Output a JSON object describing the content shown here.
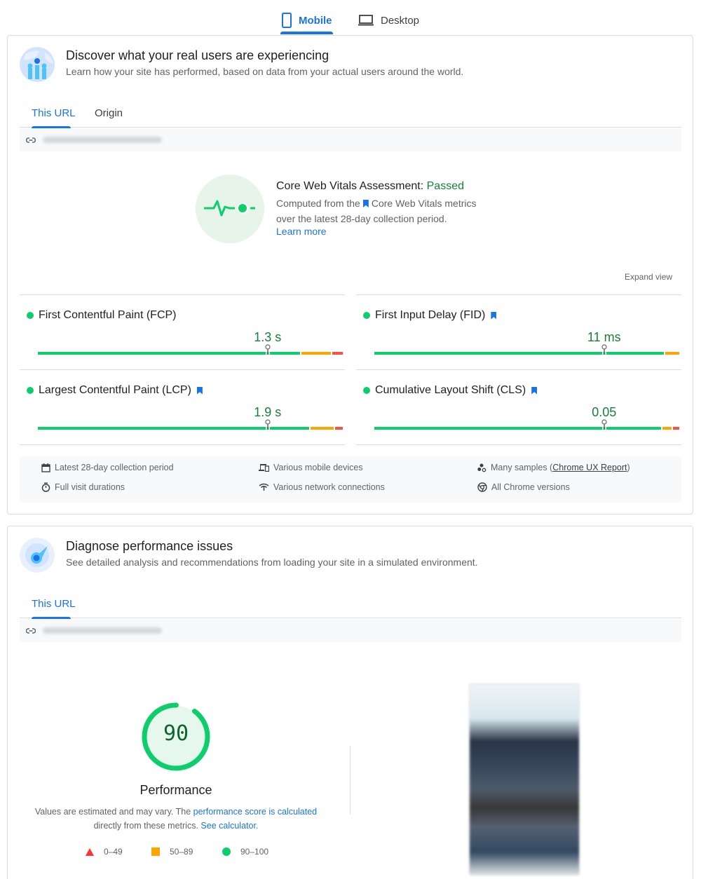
{
  "device_tabs": {
    "mobile_label": "Mobile",
    "desktop_label": "Desktop",
    "active": "Mobile"
  },
  "field_data": {
    "title": "Discover what your real users are experiencing",
    "subtitle": "Learn how your site has performed, based on data from your actual users around the world.",
    "tabs": [
      {
        "label": "This URL",
        "active": true
      },
      {
        "label": "Origin",
        "active": false
      }
    ],
    "url_blurred": "https://www.[blurred].com/",
    "assessment": {
      "title_prefix": "Core Web Vitals Assessment:",
      "status": "Passed",
      "desc_before": "Computed from the",
      "desc_after": "Core Web Vitals metrics",
      "desc_line2": "over the latest 28-day collection period.",
      "learn_more": "Learn more"
    },
    "expand_view": "Expand view",
    "metrics": [
      {
        "name": "First Contentful Paint (FCP)",
        "value": "1.3 s",
        "core": false,
        "status": "good",
        "distribution": {
          "good": 0.86,
          "needs_improvement": 0.1,
          "poor": 0.04
        },
        "percentile_marker": 0.75
      },
      {
        "name": "First Input Delay (FID)",
        "value": "11 ms",
        "core": true,
        "status": "good",
        "distribution": {
          "good": 0.95,
          "needs_improvement": 0.05,
          "poor": 0.0
        },
        "percentile_marker": 0.75
      },
      {
        "name": "Largest Contentful Paint (LCP)",
        "value": "1.9 s",
        "core": true,
        "status": "good",
        "distribution": {
          "good": 0.89,
          "needs_improvement": 0.08,
          "poor": 0.03
        },
        "percentile_marker": 0.75
      },
      {
        "name": "Cumulative Layout Shift (CLS)",
        "value": "0.05",
        "core": true,
        "status": "good",
        "distribution": {
          "good": 0.94,
          "needs_improvement": 0.035,
          "poor": 0.025
        },
        "percentile_marker": 0.75
      }
    ],
    "info": {
      "period": "Latest 28-day collection period",
      "durations": "Full visit durations",
      "devices": "Various mobile devices",
      "network": "Various network connections",
      "samples_prefix": "Many samples (",
      "samples_link": "Chrome UX Report",
      "samples_suffix": ")",
      "chrome": "All Chrome versions"
    }
  },
  "lab_data": {
    "title": "Diagnose performance issues",
    "subtitle": "See detailed analysis and recommendations from loading your site in a simulated environment.",
    "tabs": [
      {
        "label": "This URL",
        "active": true
      }
    ],
    "url_blurred": "https://www.[blurred].com/",
    "score": "90",
    "score_fraction": 0.9,
    "score_label": "Performance",
    "desc_part1": "Values are estimated and may vary. The ",
    "desc_link1": "performance score is calculated",
    "desc_part2": " directly from these metrics. ",
    "desc_link2": "See calculator.",
    "legend": [
      {
        "shape": "triangle",
        "range": "0–49",
        "color": "#ff3333"
      },
      {
        "shape": "square",
        "range": "50–89",
        "color": "#ffa400"
      },
      {
        "shape": "circle",
        "range": "90–100",
        "color": "#0cce6b"
      }
    ]
  },
  "colors": {
    "accent": "#1a73e8",
    "good": "#0cce6b",
    "average": "#ffa400",
    "poor": "#ff4e42",
    "pass_text": "#188038"
  }
}
